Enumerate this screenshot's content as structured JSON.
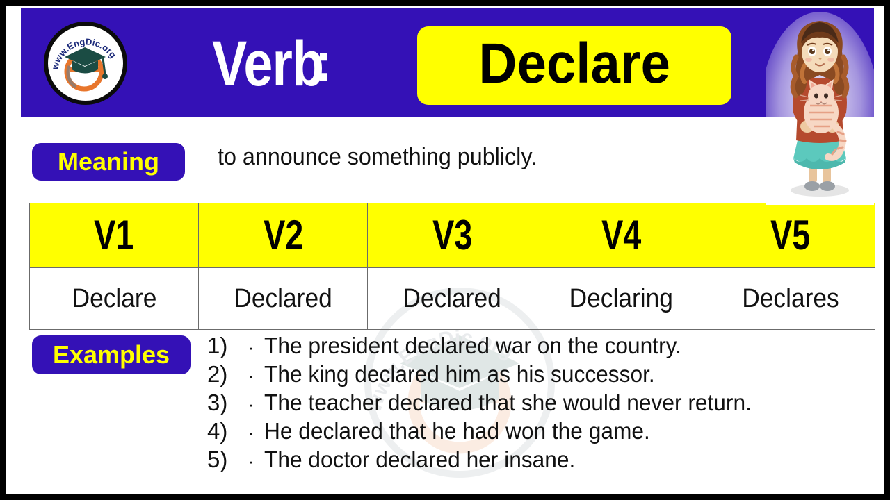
{
  "header": {
    "part_of_speech": "Verb",
    "separator": ":",
    "word": "Declare",
    "logo_text": "www.EngDic.org",
    "bg_color": "#3411b6",
    "pill_color": "#ffff00"
  },
  "meaning": {
    "label": "Meaning",
    "text": "to announce something publicly."
  },
  "table": {
    "headers": [
      "V1",
      "V2",
      "V3",
      "V4",
      "V5"
    ],
    "forms": [
      "Declare",
      "Declared",
      "Declared",
      "Declaring",
      "Declares"
    ]
  },
  "examples": {
    "label": "Examples",
    "items": [
      {
        "num": "1)",
        "bullet": "·",
        "text": "The president declared war on the country."
      },
      {
        "num": "2)",
        "bullet": "·",
        "text": "The king declared him as his successor."
      },
      {
        "num": "3)",
        "bullet": "·",
        "text": "The teacher declared that she would never return."
      },
      {
        "num": "4)",
        "bullet": "·",
        "text": "He declared that he had won the game."
      },
      {
        "num": "5)",
        "bullet": "·",
        "text": "The doctor declared her insane."
      }
    ]
  },
  "watermark": {
    "text": "www.EngDic.org"
  }
}
